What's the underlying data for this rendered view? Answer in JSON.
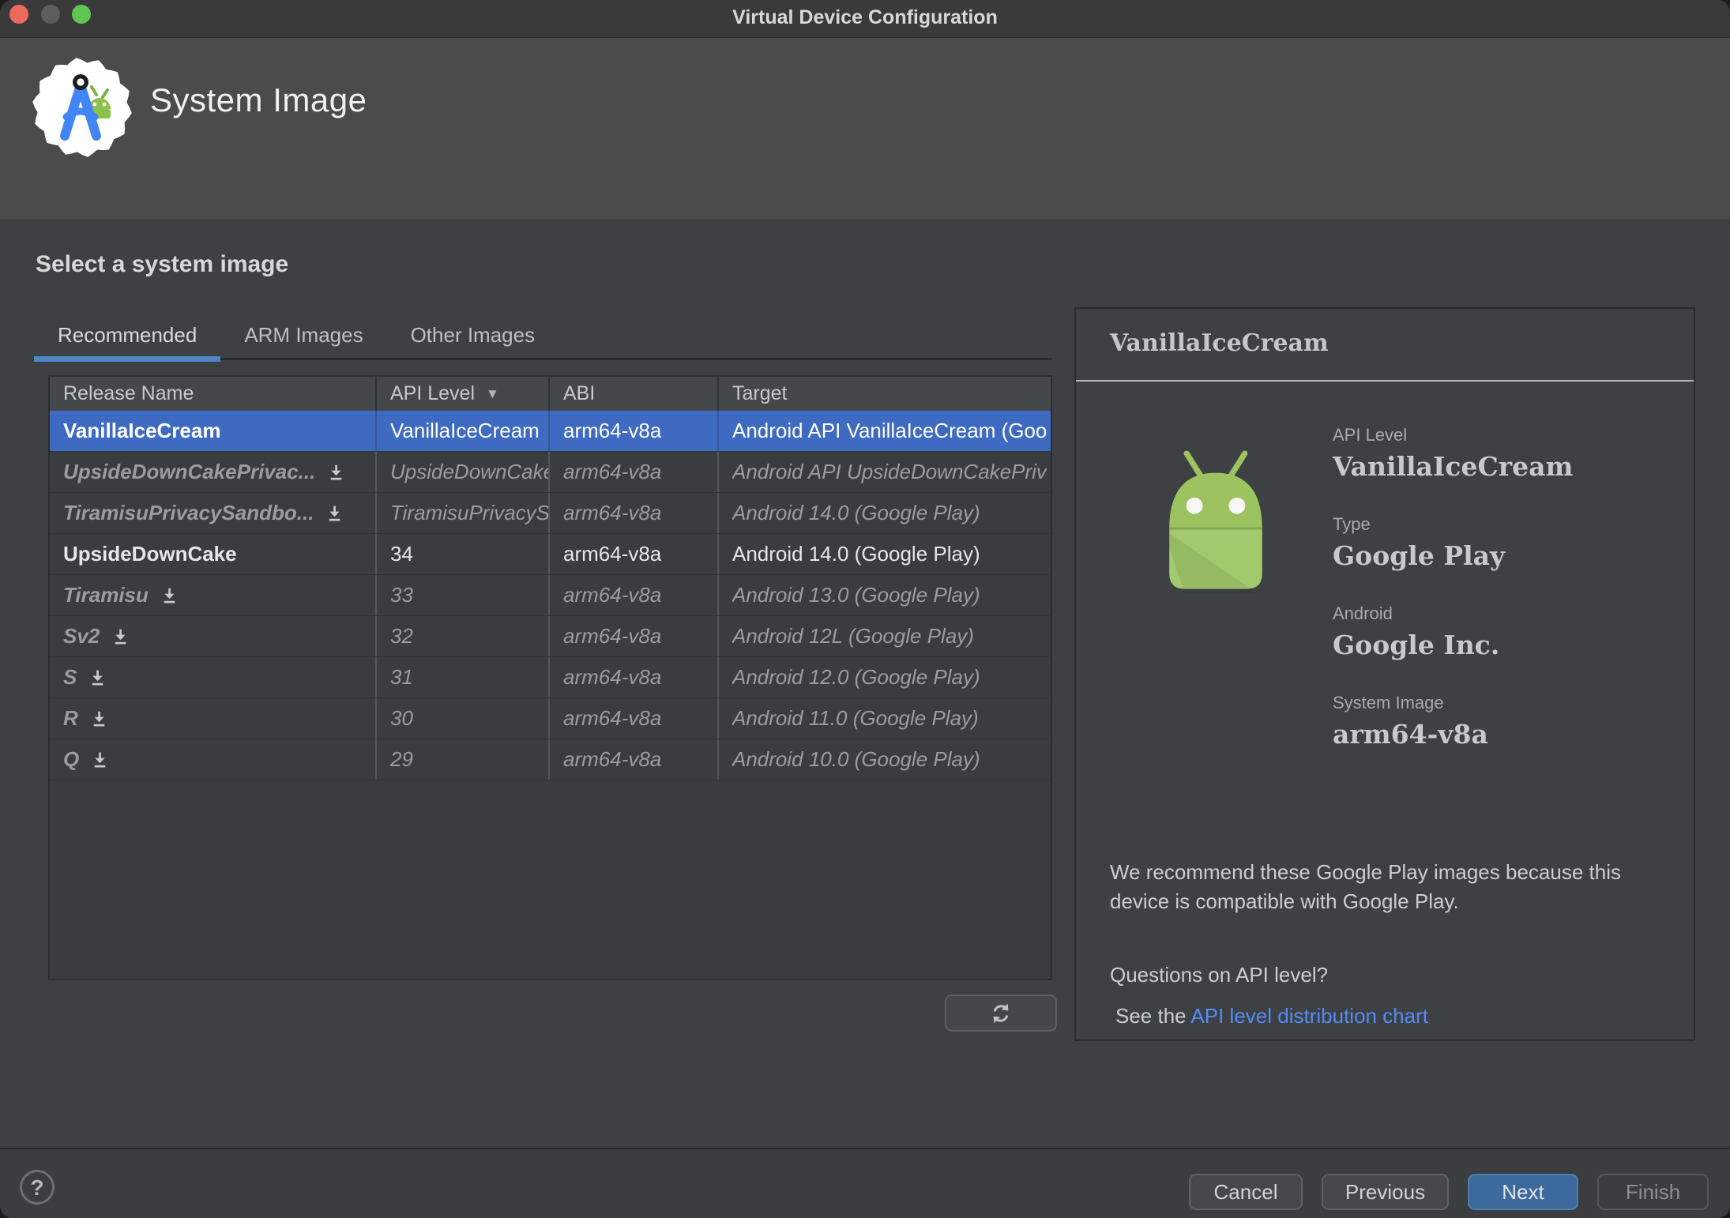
{
  "window": {
    "title": "Virtual Device Configuration"
  },
  "header": {
    "title": "System Image"
  },
  "main": {
    "heading": "Select a system image",
    "tabs": [
      {
        "label": "Recommended",
        "active": true
      },
      {
        "label": "ARM Images",
        "active": false
      },
      {
        "label": "Other Images",
        "active": false
      }
    ],
    "table": {
      "columns": [
        {
          "label": "Release Name"
        },
        {
          "label": "API Level",
          "sort": "desc"
        },
        {
          "label": "ABI"
        },
        {
          "label": "Target"
        }
      ],
      "rows": [
        {
          "release": "VanillaIceCream",
          "api": "VanillaIceCream",
          "abi": "arm64-v8a",
          "target": "Android API VanillaIceCream (Goo",
          "selected": true,
          "download": false
        },
        {
          "release": "UpsideDownCakePrivac...",
          "api": "UpsideDownCake",
          "abi": "arm64-v8a",
          "target": "Android API UpsideDownCakePriv",
          "selected": false,
          "download": true
        },
        {
          "release": "TiramisuPrivacySandbo...",
          "api": "TiramisuPrivacyS",
          "abi": "arm64-v8a",
          "target": "Android 14.0 (Google Play)",
          "selected": false,
          "download": true
        },
        {
          "release": "UpsideDownCake",
          "api": "34",
          "abi": "arm64-v8a",
          "target": "Android 14.0 (Google Play)",
          "selected": false,
          "download": false
        },
        {
          "release": "Tiramisu",
          "api": "33",
          "abi": "arm64-v8a",
          "target": "Android 13.0 (Google Play)",
          "selected": false,
          "download": true
        },
        {
          "release": "Sv2",
          "api": "32",
          "abi": "arm64-v8a",
          "target": "Android 12L (Google Play)",
          "selected": false,
          "download": true
        },
        {
          "release": "S",
          "api": "31",
          "abi": "arm64-v8a",
          "target": "Android 12.0 (Google Play)",
          "selected": false,
          "download": true
        },
        {
          "release": "R",
          "api": "30",
          "abi": "arm64-v8a",
          "target": "Android 11.0 (Google Play)",
          "selected": false,
          "download": true
        },
        {
          "release": "Q",
          "api": "29",
          "abi": "arm64-v8a",
          "target": "Android 10.0 (Google Play)",
          "selected": false,
          "download": true
        }
      ]
    }
  },
  "details": {
    "title": "VanillaIceCream",
    "fields": [
      {
        "label": "API Level",
        "value": "VanillaIceCream"
      },
      {
        "label": "Type",
        "value": "Google Play"
      },
      {
        "label": "Android",
        "value": "Google Inc."
      },
      {
        "label": "System Image",
        "value": "arm64-v8a"
      }
    ],
    "recommendation": "We recommend these Google Play images because this device is compatible with Google Play.",
    "question": "Questions on API level?",
    "see_the": "See the ",
    "link": "API level distribution chart"
  },
  "footer": {
    "help": "?",
    "cancel": "Cancel",
    "previous": "Previous",
    "next": "Next",
    "finish": "Finish"
  },
  "icons": {
    "sort_desc": "▼"
  },
  "colors": {
    "selection": "#3e6ac1",
    "tab_accent": "#4e86c8",
    "link": "#548af7",
    "next_button": "#3d6a9e",
    "android_green_head": "#9cc35f",
    "android_green_body": "#a2c96b",
    "compass_blue": "#4285f4"
  }
}
